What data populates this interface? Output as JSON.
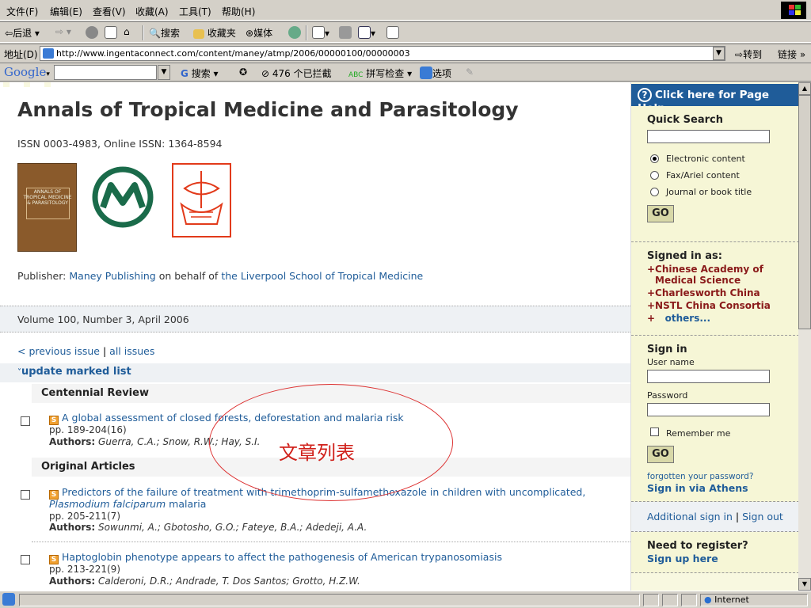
{
  "menubar": {
    "items": [
      "文件(F)",
      "编辑(E)",
      "查看(V)",
      "收藏(A)",
      "工具(T)",
      "帮助(H)"
    ]
  },
  "toolbar": {
    "back": "后退",
    "search": "搜索",
    "favorites": "收藏夹",
    "media": "媒体"
  },
  "addressbar": {
    "label": "地址(D)",
    "url": "http://www.ingentaconnect.com/content/maney/atmp/2006/00000100/00000003",
    "go": "转到",
    "links": "链接"
  },
  "googlebar": {
    "logo": "Google",
    "search": "搜索",
    "blocked": "476 个已拦截",
    "spellcheck": "拼写检查",
    "options": "选项"
  },
  "page": {
    "title": "Annals of Tropical Medicine and Parasitology",
    "issn": "ISSN 0003-4983, Online ISSN: 1364-8594",
    "cover_text": "ANNALS OF TROPICAL MEDICINE & PARASITOLOGY",
    "publisher_prefix": "Publisher:",
    "publisher": "Maney Publishing",
    "publisher_mid": "on behalf of",
    "society": "the Liverpool School of Tropical Medicine",
    "volume": "Volume 100, Number 3, April 2006",
    "previous_issue": "< previous issue",
    "divider": "|",
    "all_issues": "all issues",
    "update_marked": "update marked list",
    "annotation": "文章列表"
  },
  "sections": [
    {
      "heading": "Centennial Review",
      "articles": [
        {
          "title": "A global assessment of closed forests, deforestation and malaria risk",
          "title_italic": "",
          "title_tail": "",
          "pages": "pp. 189-204(16)",
          "authors_label": "Authors:",
          "authors": "Guerra, C.A.; Snow, R.W.; Hay, S.I."
        }
      ]
    },
    {
      "heading": "Original Articles",
      "articles": [
        {
          "title": "Predictors of the failure of treatment with trimethoprim-sulfamethoxazole in children with uncomplicated,",
          "title_italic": "Plasmodium falciparum",
          "title_tail": " malaria",
          "pages": "pp. 205-211(7)",
          "authors_label": "Authors:",
          "authors": "Sowunmi, A.; Gbotosho, G.O.; Fateye, B.A.; Adedeji, A.A."
        },
        {
          "title": "Haptoglobin phenotype appears to affect the pathogenesis of American trypanosomiasis",
          "title_italic": "",
          "title_tail": "",
          "pages": "pp. 213-221(9)",
          "authors_label": "Authors:",
          "authors": "Calderoni, D.R.; Andrade, T. Dos Santos; Grotto, H.Z.W."
        }
      ]
    }
  ],
  "sidebar": {
    "help": "Click here for Page Help",
    "quick_search": "Quick Search",
    "options": [
      "Electronic content",
      "Fax/Ariel content",
      "Journal or book title"
    ],
    "selected_option": "Electronic content",
    "go": "GO",
    "signed_in_as": "Signed in as:",
    "orgs": [
      "+Chinese Academy of",
      "Medical Science",
      "+Charlesworth China",
      "+NSTL China Consortia"
    ],
    "others_prefix": "+",
    "others": "others...",
    "sign_in": "Sign in",
    "username_label": "User name",
    "password_label": "Password",
    "remember_me": "Remember me",
    "forgotten": "forgotten your password?",
    "athens": "Sign in via Athens",
    "additional_sign_in": "Additional sign in",
    "sign_out": "Sign out",
    "need_register": "Need to register?",
    "sign_up": "Sign up here"
  },
  "statusbar": {
    "zone": "Internet"
  },
  "colors": {
    "link": "#1f5c99",
    "help_bg": "#1f5c99",
    "sidebar_bg": "#f6f6d6",
    "org_text": "#8a1a1a",
    "annotation": "#d0201a"
  }
}
